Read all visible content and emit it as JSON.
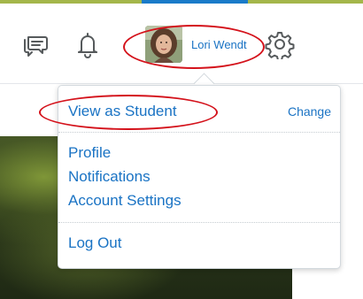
{
  "header": {
    "icons": {
      "messages": "chat-bubbles-icon",
      "notifications": "bell-icon",
      "settings": "gear-icon"
    },
    "user_name": "Lori Wendt"
  },
  "menu": {
    "view_as": "View as Student",
    "change": "Change",
    "items": [
      "Profile",
      "Notifications",
      "Account Settings"
    ],
    "logout": "Log Out"
  },
  "colors": {
    "link": "#1a73c4",
    "icon": "#565a5c",
    "annotation": "#d4121b",
    "accent_top": "#a4b64a",
    "accent_tab": "#1a7bc9"
  }
}
